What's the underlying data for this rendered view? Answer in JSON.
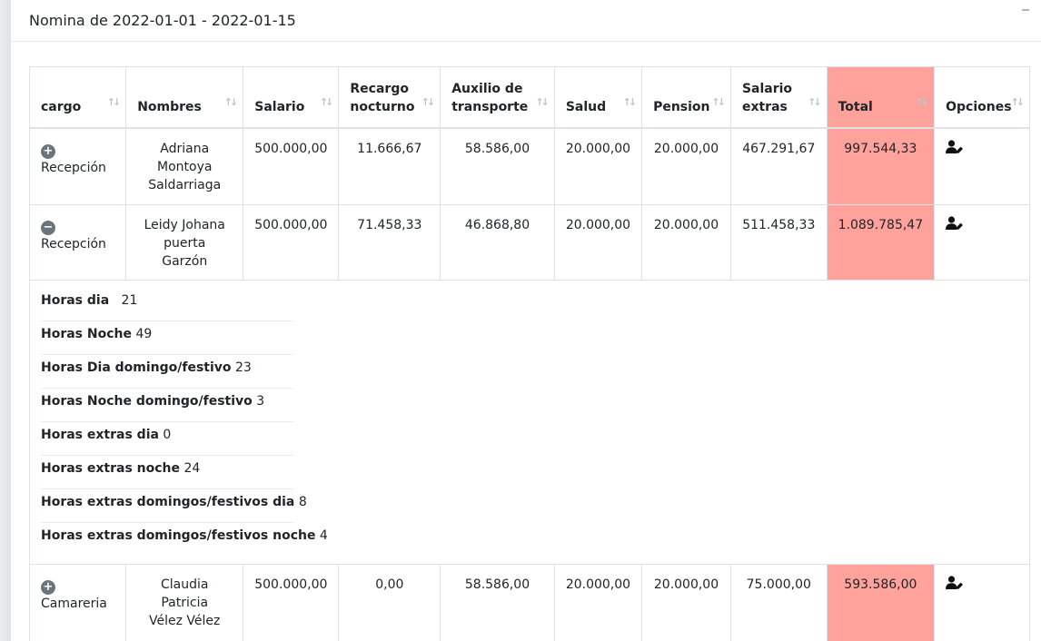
{
  "card": {
    "title": "Nomina de 2022-01-01 - 2022-01-15"
  },
  "table": {
    "headers": [
      "cargo",
      "Nombres",
      "Salario",
      "Recargo nocturno",
      "Auxilio de transporte",
      "Salud",
      "Pension",
      "Salario extras",
      "Total",
      "Opciones"
    ],
    "rows": [
      {
        "expander": "+",
        "cargo": "Recepción",
        "nombres": "Adriana Montoya Saldarriaga",
        "salario": "500.000,00",
        "recargo": "11.666,67",
        "auxilio": "58.586,00",
        "salud": "20.000,00",
        "pension": "20.000,00",
        "extras": "467.291,67",
        "total": "997.544,33"
      },
      {
        "expander": "−",
        "cargo": "Recepción",
        "nombres": "Leidy Johana puerta Garzón",
        "salario": "500.000,00",
        "recargo": "71.458,33",
        "auxilio": "46.868,80",
        "salud": "20.000,00",
        "pension": "20.000,00",
        "extras": "511.458,33",
        "total": "1.089.785,47"
      },
      {
        "expander": "+",
        "cargo": "Camareria",
        "nombres": "Claudia Patricia Vélez Vélez",
        "salario": "500.000,00",
        "recargo": "0,00",
        "auxilio": "58.586,00",
        "salud": "20.000,00",
        "pension": "20.000,00",
        "extras": "75.000,00",
        "total": "593.586,00"
      }
    ],
    "detail": [
      {
        "label": "Horas dia",
        "value": "21"
      },
      {
        "label": "Horas Noche",
        "value": "49"
      },
      {
        "label": "Horas Dia domingo/festivo",
        "value": "23"
      },
      {
        "label": "Horas Noche domingo/festivo",
        "value": "3"
      },
      {
        "label": "Horas extras dia",
        "value": "0"
      },
      {
        "label": "Horas extras noche",
        "value": "24"
      },
      {
        "label": "Horas extras domingos/festivos dia",
        "value": "8"
      },
      {
        "label": "Horas extras domingos/festivos noche",
        "value": "4"
      }
    ]
  },
  "icons": {
    "sort": "sort-arrows-icon",
    "expand": "plus-circle-icon",
    "collapse": "minus-circle-icon",
    "options": "user-edit-icon"
  },
  "colors": {
    "total_highlight": "#ffa29c"
  }
}
